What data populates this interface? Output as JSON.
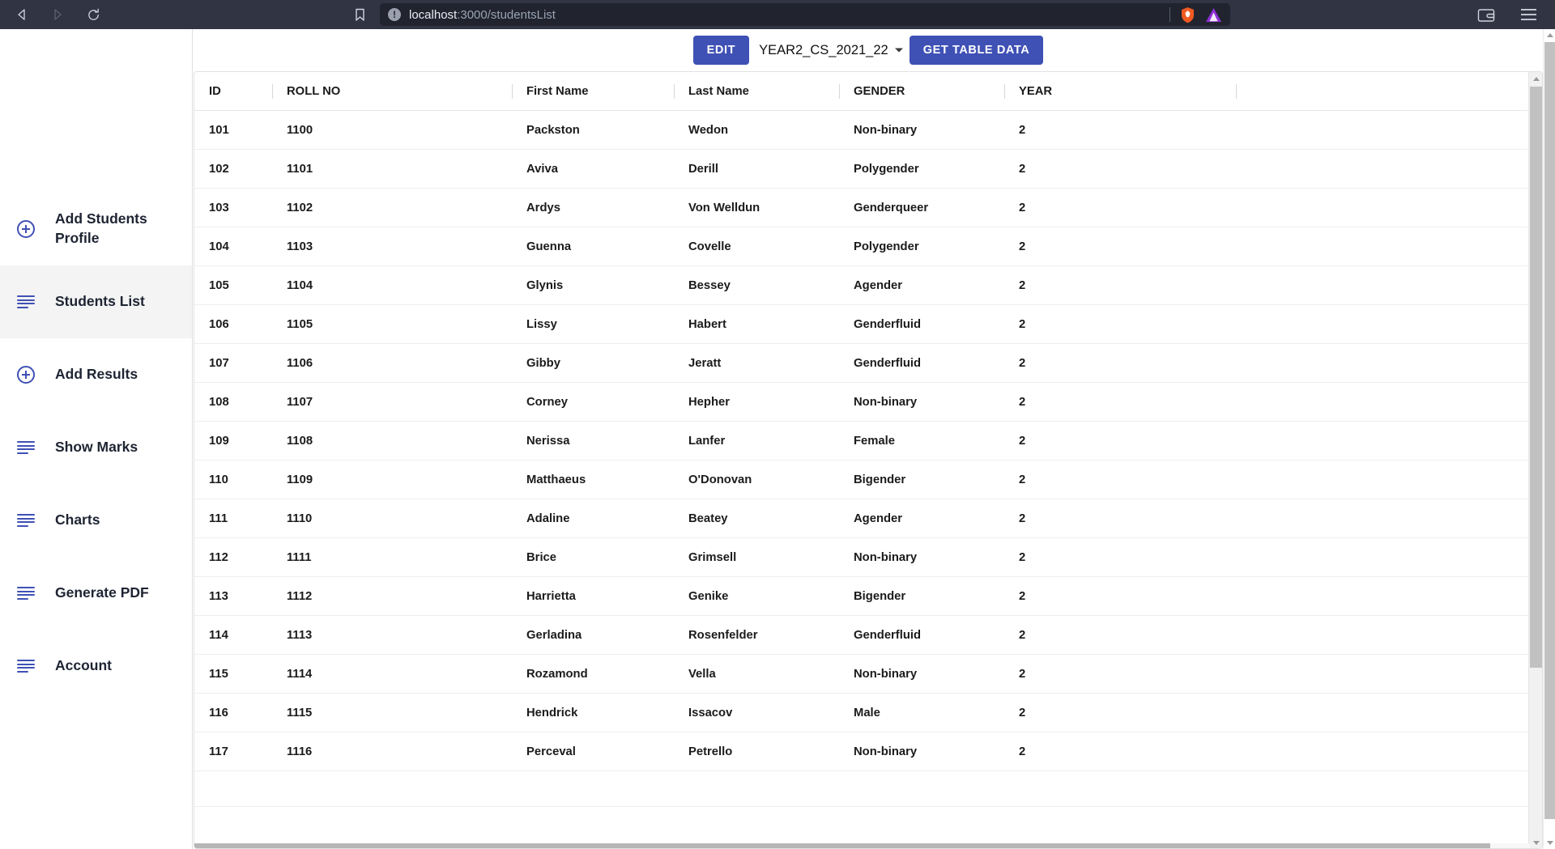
{
  "browser": {
    "back_icon": "back-arrow-icon",
    "forward_icon": "forward-arrow-icon",
    "reload_icon": "reload-icon",
    "bookmark_icon": "bookmark-icon",
    "url_host": "localhost",
    "url_path": ":3000/studentsList",
    "url_full": "localhost:3000/studentsList",
    "site_info_glyph": "!",
    "brave_shield_icon": "brave-lion-icon",
    "extension_icon": "extension-triangle-icon",
    "wallet_icon": "wallet-icon",
    "menu_icon": "hamburger-menu-icon"
  },
  "colors": {
    "chrome_bg": "#303443",
    "urlbar_bg": "#21242f",
    "accent": "#3f51b5",
    "sidebar_active": "#f4f4f4",
    "text": "#1b1b1b"
  },
  "sidebar": {
    "items": [
      {
        "label": "Add Students Profile",
        "icon": "plus-circle-icon",
        "active": false
      },
      {
        "label": "Students List",
        "icon": "list-icon",
        "active": true
      },
      {
        "label": "Add Results",
        "icon": "plus-circle-icon",
        "active": false
      },
      {
        "label": "Show Marks",
        "icon": "list-icon",
        "active": false
      },
      {
        "label": "Charts",
        "icon": "list-icon",
        "active": false
      },
      {
        "label": "Generate PDF",
        "icon": "list-icon",
        "active": false
      },
      {
        "label": "Account",
        "icon": "list-icon",
        "active": false
      }
    ]
  },
  "toolbar": {
    "edit_label": "EDIT",
    "table_select_value": "YEAR2_CS_2021_22",
    "table_select_caret": "chevron-down-icon",
    "get_table_data_label": "GET TABLE DATA"
  },
  "table": {
    "columns": [
      "ID",
      "ROLL NO",
      "First Name",
      "Last Name",
      "GENDER",
      "YEAR",
      ""
    ],
    "rows": [
      [
        "101",
        "1100",
        "Packston",
        "Wedon",
        "Non-binary",
        "2",
        ""
      ],
      [
        "102",
        "1101",
        "Aviva",
        "Derill",
        "Polygender",
        "2",
        ""
      ],
      [
        "103",
        "1102",
        "Ardys",
        "Von Welldun",
        "Genderqueer",
        "2",
        ""
      ],
      [
        "104",
        "1103",
        "Guenna",
        "Covelle",
        "Polygender",
        "2",
        ""
      ],
      [
        "105",
        "1104",
        "Glynis",
        "Bessey",
        "Agender",
        "2",
        ""
      ],
      [
        "106",
        "1105",
        "Lissy",
        "Habert",
        "Genderfluid",
        "2",
        ""
      ],
      [
        "107",
        "1106",
        "Gibby",
        "Jeratt",
        "Genderfluid",
        "2",
        ""
      ],
      [
        "108",
        "1107",
        "Corney",
        "Hepher",
        "Non-binary",
        "2",
        ""
      ],
      [
        "109",
        "1108",
        "Nerissa",
        "Lanfer",
        "Female",
        "2",
        ""
      ],
      [
        "110",
        "1109",
        "Matthaeus",
        "O'Donovan",
        "Bigender",
        "2",
        ""
      ],
      [
        "111",
        "1110",
        "Adaline",
        "Beatey",
        "Agender",
        "2",
        ""
      ],
      [
        "112",
        "1111",
        "Brice",
        "Grimsell",
        "Non-binary",
        "2",
        ""
      ],
      [
        "113",
        "1112",
        "Harrietta",
        "Genike",
        "Bigender",
        "2",
        ""
      ],
      [
        "114",
        "1113",
        "Gerladina",
        "Rosenfelder",
        "Genderfluid",
        "2",
        ""
      ],
      [
        "115",
        "1114",
        "Rozamond",
        "Vella",
        "Non-binary",
        "2",
        ""
      ],
      [
        "116",
        "1115",
        "Hendrick",
        "Issacov",
        "Male",
        "2",
        ""
      ],
      [
        "117",
        "1116",
        "Perceval",
        "Petrello",
        "Non-binary",
        "2",
        ""
      ],
      [
        "",
        "",
        "",
        "",
        "",
        "",
        ""
      ]
    ]
  }
}
